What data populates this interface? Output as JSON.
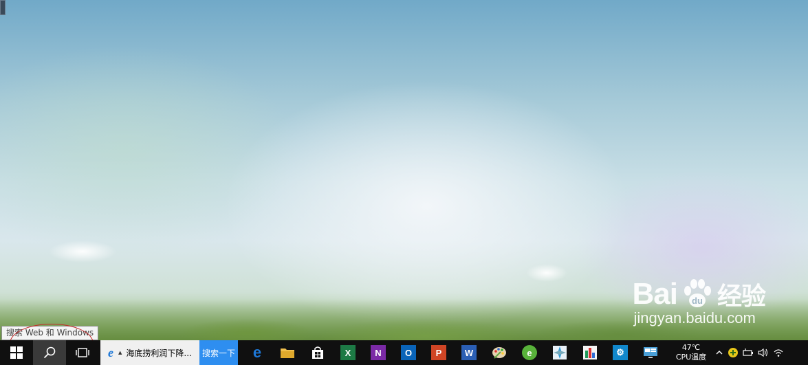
{
  "tooltip": {
    "text": "搜索 Web 和 Windows"
  },
  "watermark": {
    "brand": "Bai",
    "brand_suffix": "经验",
    "url": "jingyan.baidu.com"
  },
  "taskbar": {
    "start_icon": "windows-logo-icon",
    "search_icon": "search-icon",
    "task_view_icon": "task-view-icon",
    "ie_search": {
      "icon": "ie-icon",
      "text": "海底捞利润下降...",
      "button_label": "搜索一下"
    },
    "pinned_apps": [
      {
        "name": "edge",
        "icon": "edge-icon",
        "color": "#1e78d7",
        "glyph": "e"
      },
      {
        "name": "file-explorer",
        "icon": "folder-icon",
        "color": "#f2c14e",
        "glyph": ""
      },
      {
        "name": "store",
        "icon": "store-icon",
        "color": "#ffffff",
        "glyph": ""
      },
      {
        "name": "excel",
        "icon": "excel-icon",
        "color": "#1d7a45",
        "glyph": "X"
      },
      {
        "name": "onenote",
        "icon": "onenote-icon",
        "color": "#7b2aa6",
        "glyph": "N"
      },
      {
        "name": "outlook",
        "icon": "outlook-icon",
        "color": "#0a64b8",
        "glyph": "O"
      },
      {
        "name": "powerpoint",
        "icon": "powerpoint-icon",
        "color": "#d04525",
        "glyph": "P"
      },
      {
        "name": "word",
        "icon": "word-icon",
        "color": "#2b5fb4",
        "glyph": "W"
      },
      {
        "name": "paint",
        "icon": "paint-palette-icon",
        "color": "#c9a36a",
        "glyph": ""
      },
      {
        "name": "browser-green",
        "icon": "green-browser-icon",
        "color": "#58b23a",
        "glyph": "e"
      },
      {
        "name": "app-maps",
        "icon": "compass-app-icon",
        "color": "#2f9ad6",
        "glyph": ""
      },
      {
        "name": "app-charts",
        "icon": "chart-app-icon",
        "color": "#1f9a5a",
        "glyph": ""
      },
      {
        "name": "settings",
        "icon": "gear-icon",
        "color": "#1188cc",
        "glyph": "⚙"
      },
      {
        "name": "app-monitor",
        "icon": "monitor-app-icon",
        "color": "#4aa0d8",
        "glyph": ""
      }
    ],
    "cpu_temp": {
      "value": "47℃",
      "label": "CPU温度"
    },
    "tray_icons": [
      "chevron-up-icon",
      "plus-badge-icon",
      "battery-icon",
      "volume-icon",
      "wifi-icon"
    ]
  }
}
